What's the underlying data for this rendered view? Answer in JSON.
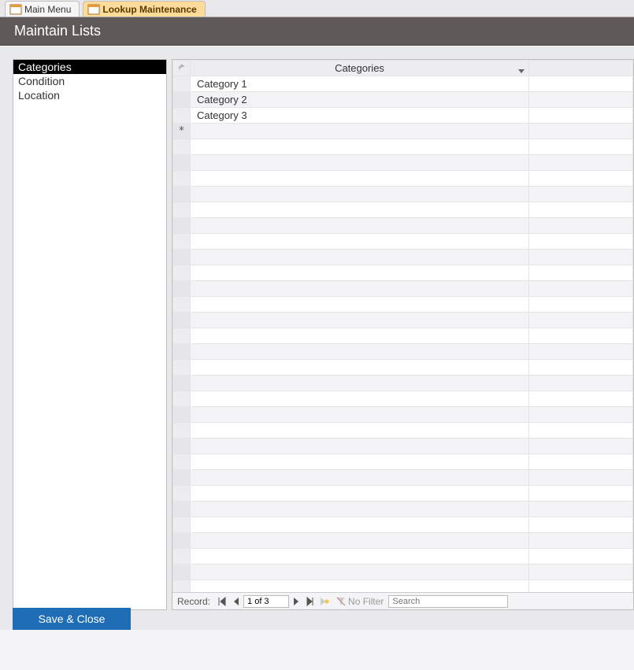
{
  "tabs": [
    {
      "label": "Main Menu",
      "active": false
    },
    {
      "label": "Lookup Maintenance",
      "active": true
    }
  ],
  "title": "Maintain Lists",
  "leftlist": {
    "items": [
      "Categories",
      "Condition",
      "Location"
    ],
    "selected_index": 0
  },
  "grid": {
    "column_header": "Categories",
    "rows": [
      "Category 1",
      "Category 2",
      "Category 3"
    ],
    "new_row_marker": "*"
  },
  "navbar": {
    "label": "Record:",
    "position": "1 of 3",
    "filter_label": "No Filter",
    "search_placeholder": "Search"
  },
  "save_button": "Save & Close"
}
